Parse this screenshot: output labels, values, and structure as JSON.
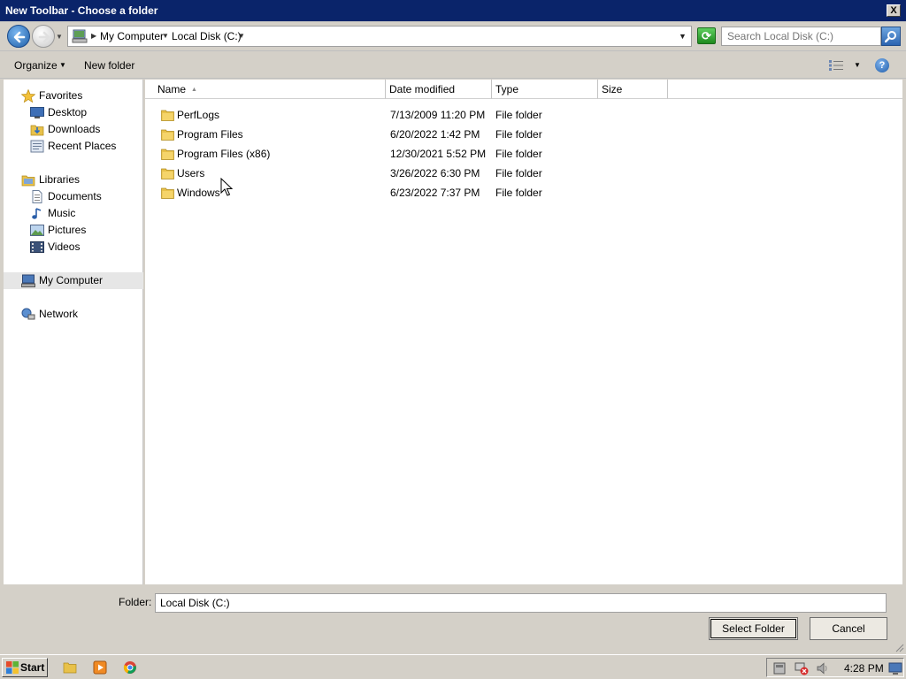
{
  "window": {
    "title": "New Toolbar - Choose a folder",
    "close_glyph": "X"
  },
  "address": {
    "crumbs": [
      "My Computer",
      "Local Disk (C:)"
    ],
    "search_placeholder": "Search Local Disk (C:)"
  },
  "toolbar": {
    "organize_label": "Organize",
    "new_folder_label": "New folder",
    "help_glyph": "?"
  },
  "nav": {
    "favorites": {
      "label": "Favorites",
      "items": [
        {
          "label": "Desktop",
          "icon": "desktop-icon"
        },
        {
          "label": "Downloads",
          "icon": "downloads-icon"
        },
        {
          "label": "Recent Places",
          "icon": "recent-places-icon"
        }
      ]
    },
    "libraries": {
      "label": "Libraries",
      "items": [
        {
          "label": "Documents",
          "icon": "documents-icon"
        },
        {
          "label": "Music",
          "icon": "music-icon"
        },
        {
          "label": "Pictures",
          "icon": "pictures-icon"
        },
        {
          "label": "Videos",
          "icon": "videos-icon"
        }
      ]
    },
    "my_computer": "My Computer",
    "network": "Network"
  },
  "columns": [
    "Name",
    "Date modified",
    "Type",
    "Size"
  ],
  "files": [
    {
      "name": "PerfLogs",
      "modified": "7/13/2009 11:20 PM",
      "type": "File folder",
      "size": ""
    },
    {
      "name": "Program Files",
      "modified": "6/20/2022 1:42 PM",
      "type": "File folder",
      "size": ""
    },
    {
      "name": "Program Files (x86)",
      "modified": "12/30/2021 5:52 PM",
      "type": "File folder",
      "size": ""
    },
    {
      "name": "Users",
      "modified": "3/26/2022 6:30 PM",
      "type": "File folder",
      "size": ""
    },
    {
      "name": "Windows",
      "modified": "6/23/2022 7:37 PM",
      "type": "File folder",
      "size": ""
    }
  ],
  "footer": {
    "folder_label": "Folder:",
    "folder_value": "Local Disk (C:)",
    "select_label": "Select Folder",
    "cancel_label": "Cancel"
  },
  "taskbar": {
    "start_label": "Start",
    "clock": "4:28 PM"
  },
  "colors": {
    "titlebar": "#0a246a",
    "accent": "#1f5fa8",
    "folder": "#e8c14a"
  }
}
